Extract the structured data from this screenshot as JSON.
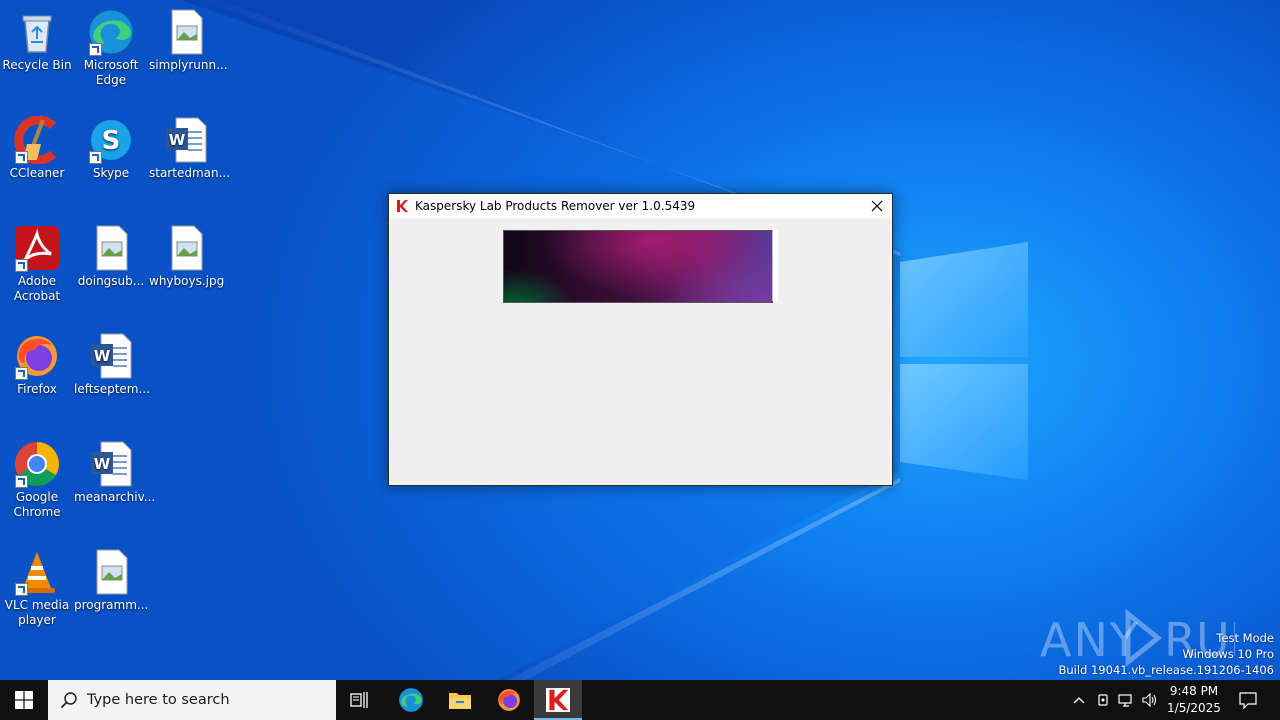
{
  "desktop": {
    "icons": [
      {
        "label": "Recycle Bin",
        "icon": "recycle-bin-icon"
      },
      {
        "label": "Microsoft Edge",
        "icon": "edge-icon"
      },
      {
        "label": "simplyrunn...",
        "icon": "image-file-icon"
      },
      {
        "label": "CCleaner",
        "icon": "ccleaner-icon"
      },
      {
        "label": "Skype",
        "icon": "skype-icon"
      },
      {
        "label": "startedman...",
        "icon": "word-doc-icon"
      },
      {
        "label": "Adobe Acrobat",
        "icon": "acrobat-icon"
      },
      {
        "label": "doingsub...",
        "icon": "image-file-icon"
      },
      {
        "label": "whyboys.jpg",
        "icon": "image-file-icon"
      },
      {
        "label": "Firefox",
        "icon": "firefox-icon"
      },
      {
        "label": "leftseptem...",
        "icon": "word-doc-icon"
      },
      {
        "label": "Google Chrome",
        "icon": "chrome-icon"
      },
      {
        "label": "meanarchiv...",
        "icon": "word-doc-icon"
      },
      {
        "label": "VLC media player",
        "icon": "vlc-icon"
      },
      {
        "label": "programm...",
        "icon": "image-file-icon"
      }
    ]
  },
  "window": {
    "title": "Kaspersky Lab Products Remover ver 1.0.5439",
    "icon": "kaspersky-icon"
  },
  "watermark": {
    "brand": "ANY RUN",
    "line1": "Test Mode",
    "line2": "Windows 10 Pro",
    "line3": "Build 19041.vb_release.191206-1406"
  },
  "taskbar": {
    "search_placeholder": "Type here to search",
    "apps": [
      "task-view-icon",
      "edge-icon",
      "file-explorer-icon",
      "firefox-icon",
      "kaspersky-icon"
    ],
    "active_app": "kaspersky-icon",
    "clock": {
      "time": "9:48 PM",
      "date": "1/5/2025"
    }
  },
  "colors": {
    "taskbar": "#101010",
    "wallpaper": "#0a5fd6",
    "accent": "#76b9ed",
    "kaspersky_red": "#d61f1f"
  }
}
